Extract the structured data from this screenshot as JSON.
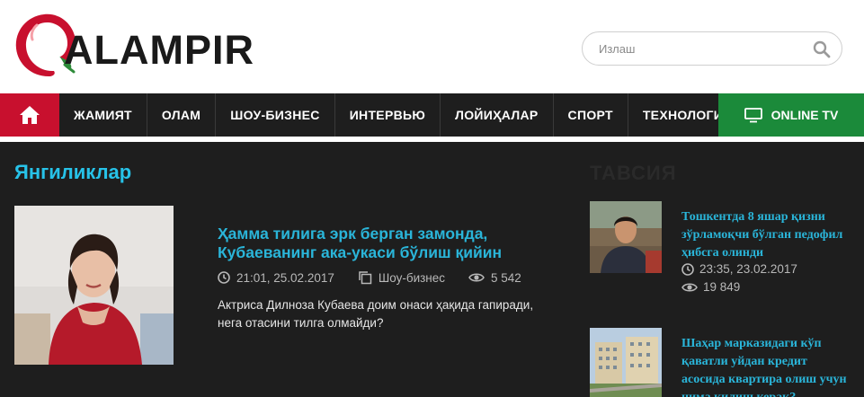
{
  "header": {
    "logo_text": "ALAMPIR",
    "search_placeholder": "Излаш"
  },
  "nav": {
    "items": [
      "ЖАМИЯТ",
      "ОЛАМ",
      "ШОУ-БИЗНЕС",
      "ИНТЕРВЬЮ",
      "ЛОЙИҲАЛАР",
      "СПОРТ",
      "ТЕХНОЛОГИЯ"
    ],
    "tv_label": "ONLINE TV"
  },
  "main": {
    "section_title": "Янгиликлар",
    "side_title": "ТАВСИЯ",
    "article": {
      "title": "Ҳамма тилига эрк берган замонда, Кубаеванинг ака-укаси бўлиш қийин",
      "time": "21:01, 25.02.2017",
      "category": "Шоу-бизнес",
      "views": "5 542",
      "excerpt": "Актриса Дилноза Кубаева доим онаси ҳақида гапиради, нега отасини тилга олмайди?"
    },
    "side_items": [
      {
        "title": "Тошкентда 8 яшар қизни зўрламоқчи бўлган педофил ҳибсга олинди",
        "time": "23:35, 23.02.2017",
        "views": "19 849"
      },
      {
        "title": "Шаҳар марказидаги кўп қаватли уйдан кредит асосида квартира олиш учун нима қилиш керак?"
      }
    ]
  },
  "colors": {
    "brand_red": "#c8102e",
    "tv_green": "#1b8a3a",
    "link_blue": "#2ab5d9",
    "nav_bg": "#1e1e1e"
  },
  "icons": [
    "home-icon",
    "search-icon",
    "tv-icon",
    "clock-icon",
    "copy-icon",
    "eye-icon"
  ]
}
